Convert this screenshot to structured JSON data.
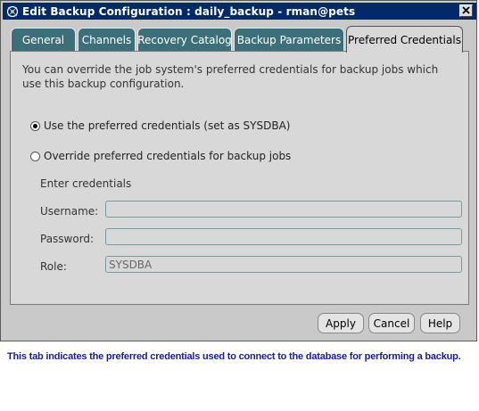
{
  "window": {
    "title": "Edit Backup Configuration : daily_backup - rman@pets",
    "close_icon": "close-icon",
    "app_icon": "oracle-em-icon"
  },
  "tabs": [
    {
      "label": "General",
      "active": false
    },
    {
      "label": "Channels",
      "active": false
    },
    {
      "label": "Recovery Catalog",
      "active": false
    },
    {
      "label": "Backup Parameters",
      "active": false
    },
    {
      "label": "Preferred Credentials",
      "active": true
    }
  ],
  "panel": {
    "intro": "You can override the job system's preferred credentials for backup jobs which use this backup configuration.",
    "options": [
      {
        "label": "Use the preferred credentials (set as SYSDBA)",
        "checked": true
      },
      {
        "label": "Override preferred credentials for backup jobs",
        "checked": false
      }
    ],
    "enter_credentials": "Enter credentials",
    "username": {
      "label": "Username:",
      "value": ""
    },
    "password": {
      "label": "Password:",
      "value": ""
    },
    "role": {
      "label": "Role:",
      "value": "SYSDBA"
    }
  },
  "buttons": {
    "apply": "Apply",
    "cancel": "Cancel",
    "help": "Help"
  },
  "caption": "This tab indicates the preferred credentials used to connect to the database for performing a backup.",
  "colors": {
    "title_bar": "#022a6b",
    "tab_inactive": "#3d6f7a",
    "panel_bg": "#d8d8d8",
    "caption_text": "#1a1a9c"
  }
}
